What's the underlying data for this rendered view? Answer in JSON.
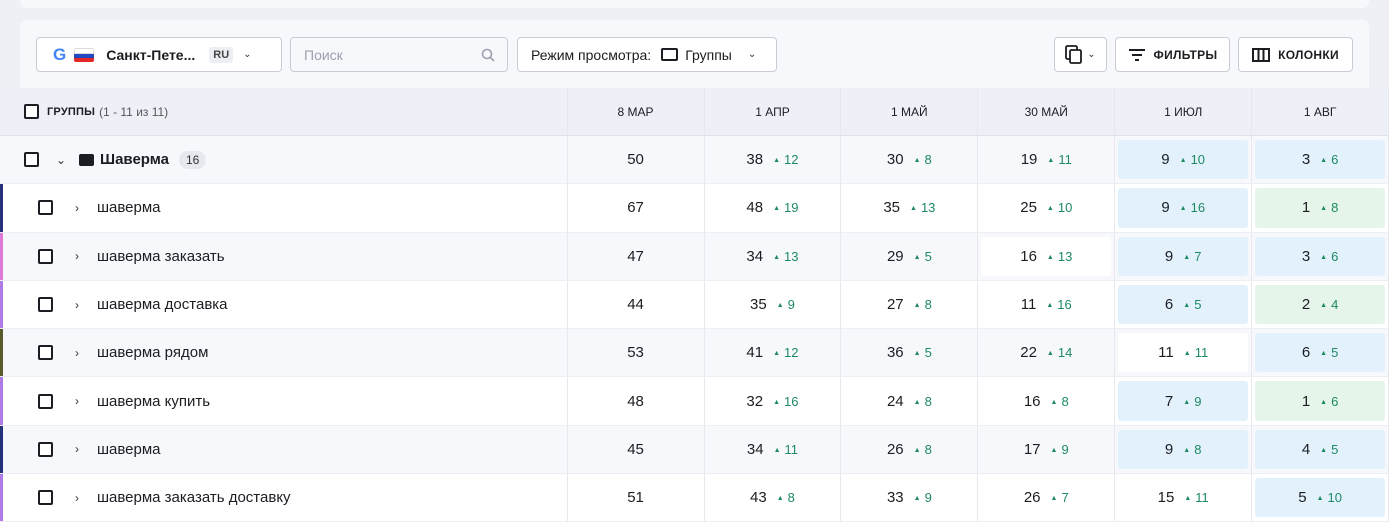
{
  "toolbar": {
    "engine": "G",
    "city": "Санкт-Пете...",
    "lang": "RU",
    "search_placeholder": "Поиск",
    "view_mode_label": "Режим просмотра:",
    "view_mode_value": "Группы",
    "filters_label": "ФИЛЬТРЫ",
    "columns_label": "КОЛОНКИ"
  },
  "table": {
    "header": {
      "title": "ГРУППЫ",
      "range": "(1 - 11 из 11)",
      "dates": [
        "8 МАР",
        "1 АПР",
        "1 МАЙ",
        "30 МАЙ",
        "1 ИЮЛ",
        "1 АВГ"
      ]
    },
    "group": {
      "name": "Шаверма",
      "count": "16",
      "cells": [
        {
          "pos": "50",
          "delta": "",
          "bg": "none"
        },
        {
          "pos": "38",
          "delta": "12",
          "bg": "none"
        },
        {
          "pos": "30",
          "delta": "8",
          "bg": "none"
        },
        {
          "pos": "19",
          "delta": "11",
          "bg": "none"
        },
        {
          "pos": "9",
          "delta": "10",
          "bg": "blue"
        },
        {
          "pos": "3",
          "delta": "6",
          "bg": "blue"
        }
      ]
    },
    "rows": [
      {
        "keyword": "шаверма",
        "bar": "#25317a",
        "cells": [
          {
            "pos": "67",
            "delta": "",
            "bg": "none"
          },
          {
            "pos": "48",
            "delta": "19",
            "bg": "none"
          },
          {
            "pos": "35",
            "delta": "13",
            "bg": "none"
          },
          {
            "pos": "25",
            "delta": "10",
            "bg": "none"
          },
          {
            "pos": "9",
            "delta": "16",
            "bg": "blue"
          },
          {
            "pos": "1",
            "delta": "8",
            "bg": "green"
          }
        ]
      },
      {
        "keyword": "шаверма заказать",
        "bar": "#e07ad8",
        "cells": [
          {
            "pos": "47",
            "delta": "",
            "bg": "none"
          },
          {
            "pos": "34",
            "delta": "13",
            "bg": "none"
          },
          {
            "pos": "29",
            "delta": "5",
            "bg": "none"
          },
          {
            "pos": "16",
            "delta": "13",
            "bg": "white"
          },
          {
            "pos": "9",
            "delta": "7",
            "bg": "blue"
          },
          {
            "pos": "3",
            "delta": "6",
            "bg": "blue"
          }
        ]
      },
      {
        "keyword": "шаверма доставка",
        "bar": "#b07be6",
        "cells": [
          {
            "pos": "44",
            "delta": "",
            "bg": "none"
          },
          {
            "pos": "35",
            "delta": "9",
            "bg": "none"
          },
          {
            "pos": "27",
            "delta": "8",
            "bg": "none"
          },
          {
            "pos": "11",
            "delta": "16",
            "bg": "none"
          },
          {
            "pos": "6",
            "delta": "5",
            "bg": "blue"
          },
          {
            "pos": "2",
            "delta": "4",
            "bg": "green"
          }
        ]
      },
      {
        "keyword": "шаверма рядом",
        "bar": "#5b5a2a",
        "cells": [
          {
            "pos": "53",
            "delta": "",
            "bg": "none"
          },
          {
            "pos": "41",
            "delta": "12",
            "bg": "none"
          },
          {
            "pos": "36",
            "delta": "5",
            "bg": "none"
          },
          {
            "pos": "22",
            "delta": "14",
            "bg": "none"
          },
          {
            "pos": "11",
            "delta": "11",
            "bg": "white"
          },
          {
            "pos": "6",
            "delta": "5",
            "bg": "blue"
          }
        ]
      },
      {
        "keyword": "шаверма купить",
        "bar": "#b07be6",
        "cells": [
          {
            "pos": "48",
            "delta": "",
            "bg": "none"
          },
          {
            "pos": "32",
            "delta": "16",
            "bg": "none"
          },
          {
            "pos": "24",
            "delta": "8",
            "bg": "none"
          },
          {
            "pos": "16",
            "delta": "8",
            "bg": "none"
          },
          {
            "pos": "7",
            "delta": "9",
            "bg": "blue"
          },
          {
            "pos": "1",
            "delta": "6",
            "bg": "green"
          }
        ]
      },
      {
        "keyword": "шаверма",
        "bar": "#25317a",
        "cells": [
          {
            "pos": "45",
            "delta": "",
            "bg": "none"
          },
          {
            "pos": "34",
            "delta": "11",
            "bg": "none"
          },
          {
            "pos": "26",
            "delta": "8",
            "bg": "none"
          },
          {
            "pos": "17",
            "delta": "9",
            "bg": "none"
          },
          {
            "pos": "9",
            "delta": "8",
            "bg": "blue"
          },
          {
            "pos": "4",
            "delta": "5",
            "bg": "blue"
          }
        ]
      },
      {
        "keyword": "шаверма заказать доставку",
        "bar": "#b07be6",
        "cells": [
          {
            "pos": "51",
            "delta": "",
            "bg": "none"
          },
          {
            "pos": "43",
            "delta": "8",
            "bg": "none"
          },
          {
            "pos": "33",
            "delta": "9",
            "bg": "none"
          },
          {
            "pos": "26",
            "delta": "7",
            "bg": "none"
          },
          {
            "pos": "15",
            "delta": "11",
            "bg": "none"
          },
          {
            "pos": "5",
            "delta": "10",
            "bg": "blue"
          }
        ]
      }
    ]
  }
}
